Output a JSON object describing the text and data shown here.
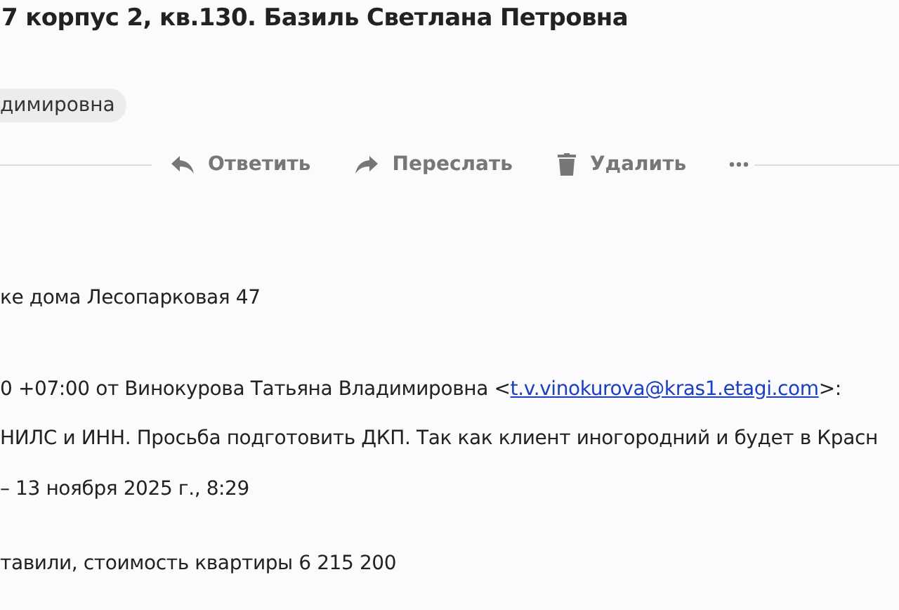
{
  "subject": "7 корпус 2, кв.130. Базиль Светлана Петровна",
  "recipient_chip": "димировна",
  "actions": [
    {
      "label": "Ответить",
      "kind": "reply"
    },
    {
      "label": "Переслать",
      "kind": "forward"
    },
    {
      "label": "Удалить",
      "kind": "delete"
    }
  ],
  "body": [
    {
      "kind": "text",
      "text": "ке дома Лесопарковая 47"
    },
    {
      "kind": "header",
      "before": "0 +07:00 от Винокурова Татьяна Владимировна <",
      "email": "t.v.vinokurova@kras1.etagi.com",
      "after": ">:"
    },
    {
      "kind": "text",
      "text": "НИЛС и ИНН. Просьба подготовить ДКП. Так как клиент иногородний и будет в Красн"
    },
    {
      "kind": "text",
      "text": "– 13 ноября 2025 г., 8:29"
    },
    {
      "kind": "text",
      "text": "тавили, стоимость квартиры 6 215 200"
    }
  ]
}
